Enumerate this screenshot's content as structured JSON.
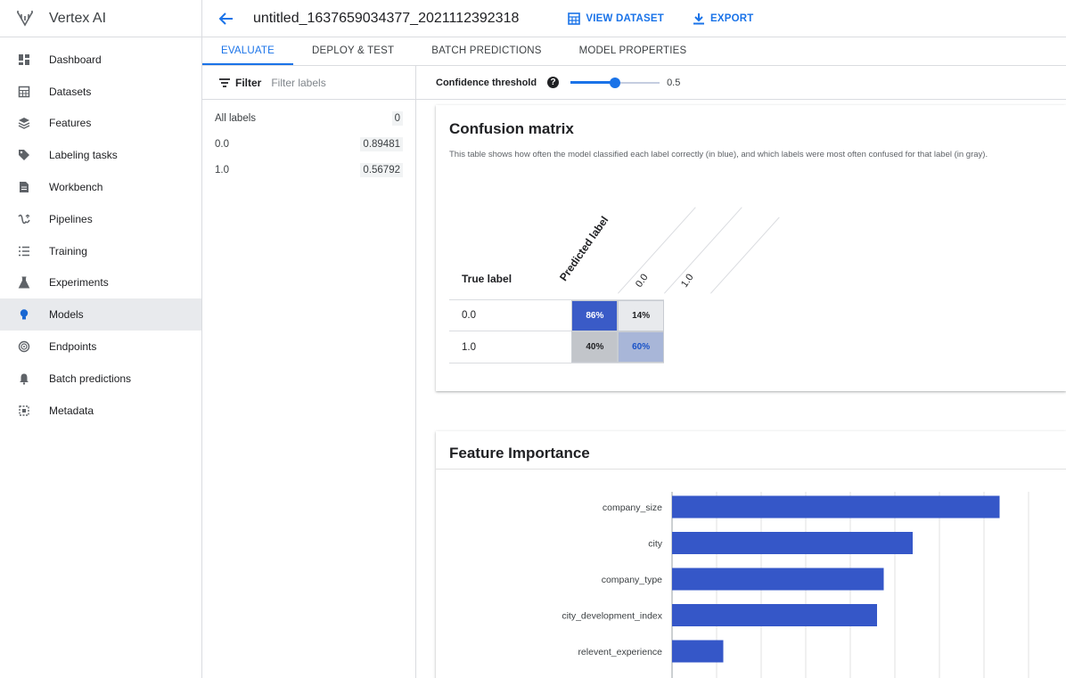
{
  "app": {
    "name": "Vertex AI"
  },
  "sidebar": {
    "items": [
      {
        "label": "Dashboard",
        "icon": "dashboard-icon"
      },
      {
        "label": "Datasets",
        "icon": "datasets-icon"
      },
      {
        "label": "Features",
        "icon": "features-icon"
      },
      {
        "label": "Labeling tasks",
        "icon": "label-icon"
      },
      {
        "label": "Workbench",
        "icon": "document-icon"
      },
      {
        "label": "Pipelines",
        "icon": "pipelines-icon"
      },
      {
        "label": "Training",
        "icon": "list-icon"
      },
      {
        "label": "Experiments",
        "icon": "flask-icon"
      },
      {
        "label": "Models",
        "icon": "lightbulb-icon",
        "active": true
      },
      {
        "label": "Endpoints",
        "icon": "endpoints-icon"
      },
      {
        "label": "Batch predictions",
        "icon": "bell-icon"
      },
      {
        "label": "Metadata",
        "icon": "metadata-icon"
      }
    ]
  },
  "header": {
    "title": "untitled_1637659034377_2021112392318",
    "view_dataset": "VIEW DATASET",
    "export": "EXPORT"
  },
  "tabs": [
    {
      "label": "EVALUATE",
      "active": true
    },
    {
      "label": "DEPLOY & TEST"
    },
    {
      "label": "BATCH PREDICTIONS"
    },
    {
      "label": "MODEL PROPERTIES"
    }
  ],
  "labels_panel": {
    "filter_label": "Filter",
    "filter_placeholder": "Filter labels",
    "rows": [
      {
        "label": "All labels",
        "value": "0"
      },
      {
        "label": "0.0",
        "value": "0.89481"
      },
      {
        "label": "1.0",
        "value": "0.56792"
      }
    ]
  },
  "threshold": {
    "label": "Confidence threshold",
    "help": "?",
    "value": "0.5",
    "level": 0.5
  },
  "confusion_matrix": {
    "title": "Confusion matrix",
    "description": "This table shows how often the model classified each label correctly (in blue), and which labels were most often confused for that label (in gray).",
    "true_label_header": "True label",
    "predicted_label_header": "Predicted label",
    "columns": [
      "0.0",
      "1.0"
    ],
    "rows": [
      {
        "label": "0.0",
        "cells": [
          "86%",
          "14%"
        ]
      },
      {
        "label": "1.0",
        "cells": [
          "40%",
          "60%"
        ]
      }
    ],
    "colors": {
      "strong_blue": "#3a5bc7",
      "light_blue": "#a8b6d8",
      "gray_light": "#e8eaed",
      "gray_mid": "#c2c5ca"
    }
  },
  "feature_importance": {
    "title": "Feature Importance",
    "bar_color": "#3557c8"
  },
  "chart_data": {
    "type": "bar",
    "orientation": "horizontal",
    "categories": [
      "company_size",
      "city",
      "company_type",
      "city_development_index",
      "relevent_experience"
    ],
    "values": [
      14.7,
      10.8,
      9.5,
      9.2,
      2.3
    ],
    "xlim": [
      0,
      16
    ],
    "grid": true,
    "title": ""
  }
}
